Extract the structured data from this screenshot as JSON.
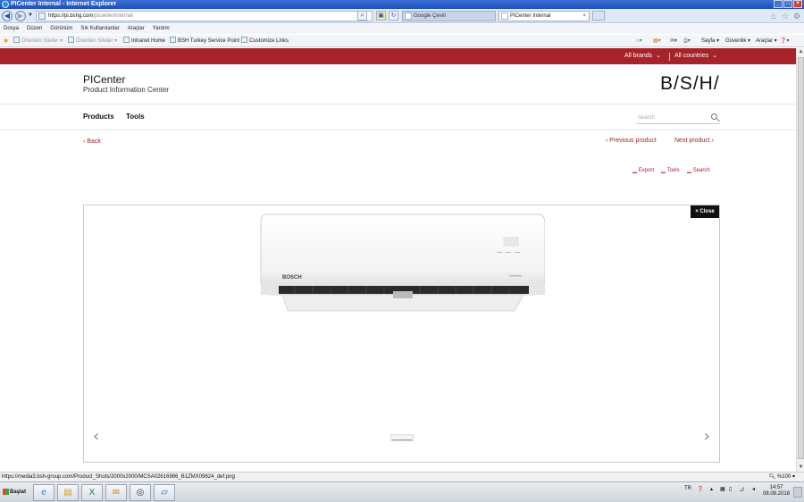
{
  "window": {
    "title": "PICenter Internal - Internet Explorer"
  },
  "address_bar": {
    "url_prefix": "https://pi.bshg.com",
    "url_path": "/picenter/internal"
  },
  "tabs": [
    {
      "label": "Google Çeviri",
      "active": false
    },
    {
      "label": "PICenter Internal",
      "active": true
    }
  ],
  "menu": [
    "Dosya",
    "Düzen",
    "Görünüm",
    "Sık Kullanılanlar",
    "Araçlar",
    "Yardım"
  ],
  "favorites": [
    {
      "label": "Önerilen Siteler",
      "dim": true
    },
    {
      "label": "Önerilen Siteler",
      "dim": true
    },
    {
      "label": "Intranet Home",
      "dim": false
    },
    {
      "label": "BSH Turkey Service Point",
      "dim": false
    },
    {
      "label": "Customize Links",
      "dim": false
    }
  ],
  "command_bar": {
    "page": "Sayfa",
    "safety": "Güvenlik",
    "tools": "Araçlar"
  },
  "site": {
    "all_brands": "All brands",
    "all_countries": "All countries",
    "title": "PICenter",
    "subtitle": "Product Information Center",
    "logo": "B/S/H/",
    "nav": {
      "products": "Products",
      "tools": "Tools"
    },
    "search_placeholder": "Search",
    "back": "Back",
    "previous_product": "Previous product",
    "next_product": "Next product",
    "export": "Export",
    "tools_link": "Tools",
    "search_link": "Search"
  },
  "viewer": {
    "close": "× Close",
    "ac_brand": "BOSCH",
    "accent_color": "#a6232a"
  },
  "status_bar": {
    "url": "https://media3.bsh-group.com/Product_Shots/2000x2000/MCSA02616986_B1ZMX09624_def.png",
    "zoom": "%100"
  },
  "taskbar": {
    "start": "Başlat",
    "lang": "TR",
    "time": "14:57",
    "date": "08.08.2018"
  }
}
